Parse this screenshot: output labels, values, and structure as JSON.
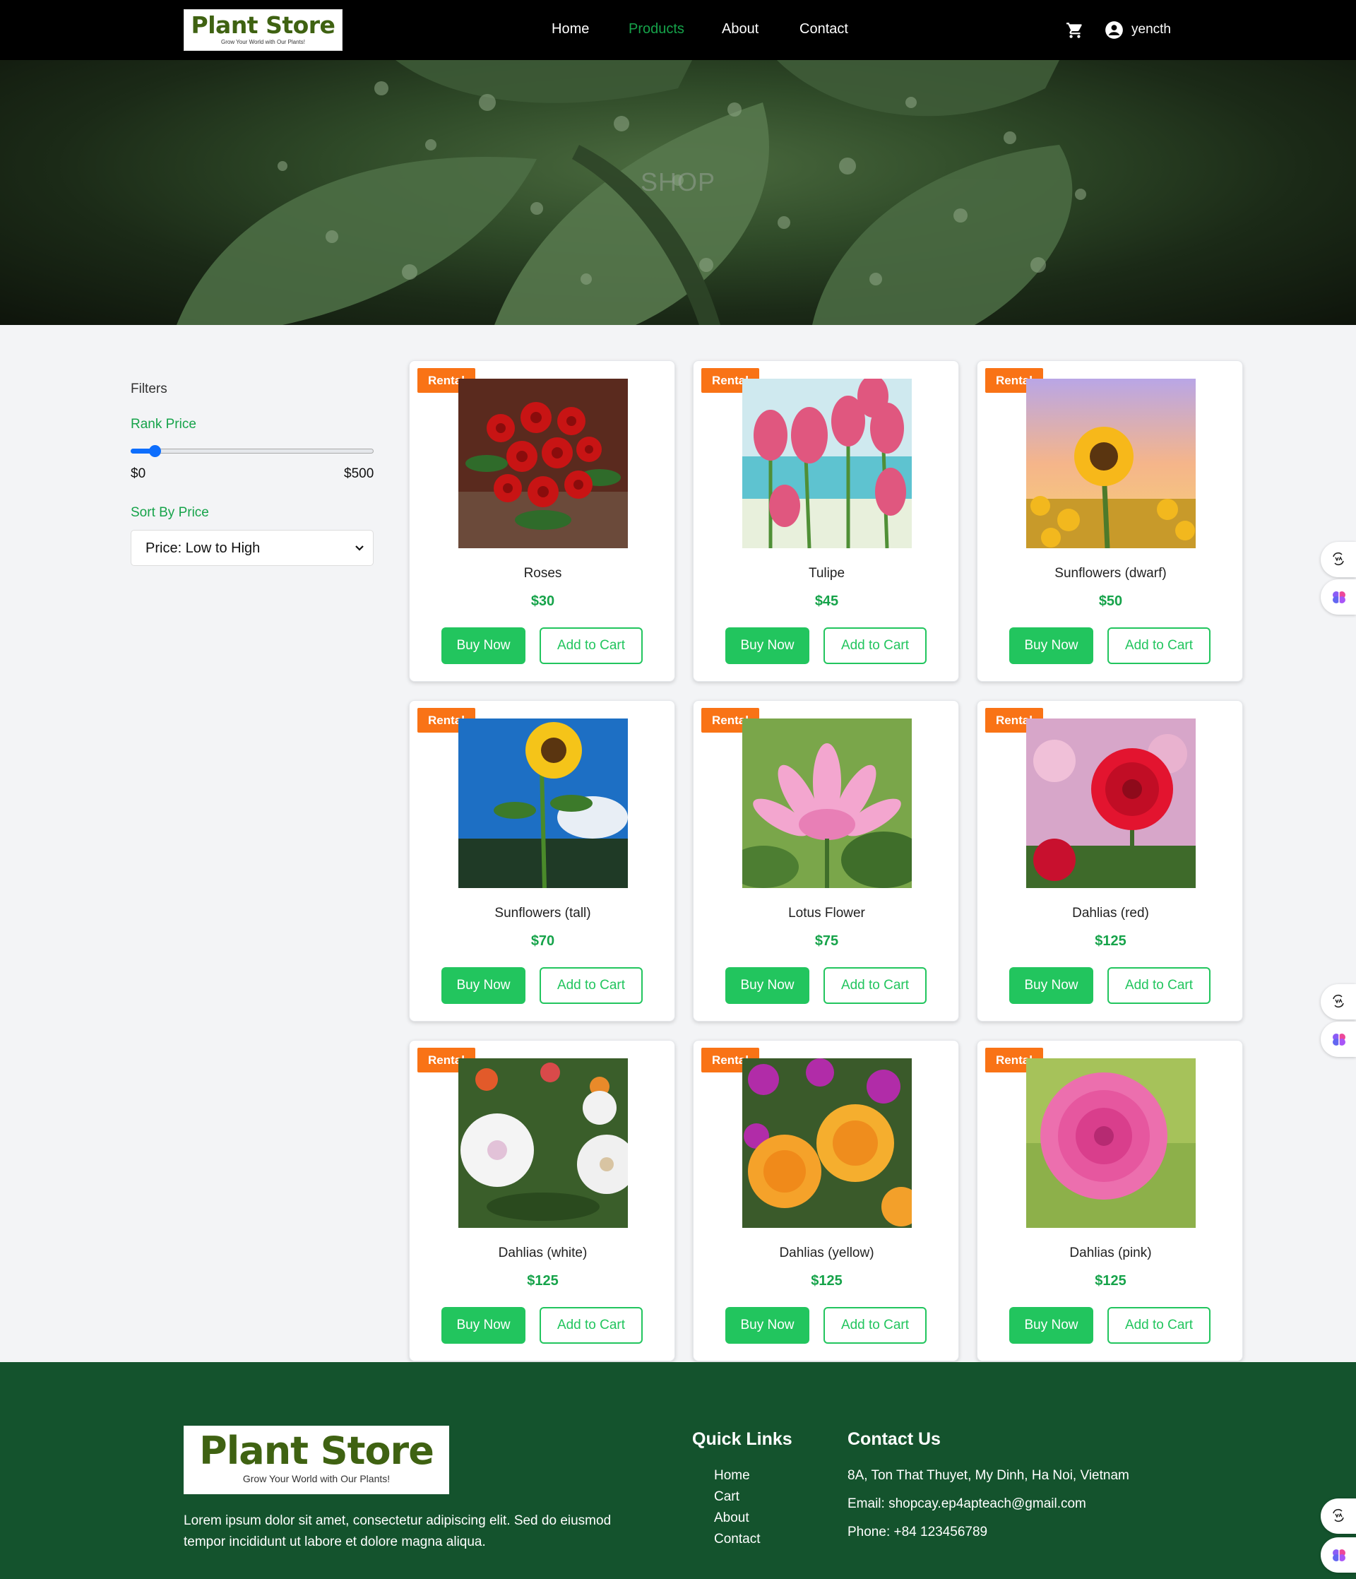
{
  "brand": {
    "name": "Plant Store",
    "tagline": "Grow Your World with Our Plants!"
  },
  "nav": {
    "items": [
      "Home",
      "Products",
      "About",
      "Contact"
    ],
    "active": "Products",
    "cart_icon": "cart-icon",
    "user_icon": "user-circle-icon",
    "user_name": "yencth"
  },
  "hero": {
    "title": "SHOP"
  },
  "filters": {
    "title": "Filters",
    "rank_label": "Rank Price",
    "min_label": "$0",
    "max_label": "$500",
    "slider_value_fraction": 0.1,
    "sort_label": "Sort By Price",
    "sort_selected": "Price: Low to High"
  },
  "products": [
    {
      "badge": "Rental",
      "name": "Roses",
      "price": "$30",
      "buy": "Buy Now",
      "cart": "Add to Cart"
    },
    {
      "badge": "Rental",
      "name": "Tulipe",
      "price": "$45",
      "buy": "Buy Now",
      "cart": "Add to Cart"
    },
    {
      "badge": "Rental",
      "name": "Sunflowers (dwarf)",
      "price": "$50",
      "buy": "Buy Now",
      "cart": "Add to Cart"
    },
    {
      "badge": "Rental",
      "name": "Sunflowers (tall)",
      "price": "$70",
      "buy": "Buy Now",
      "cart": "Add to Cart"
    },
    {
      "badge": "Rental",
      "name": "Lotus Flower",
      "price": "$75",
      "buy": "Buy Now",
      "cart": "Add to Cart"
    },
    {
      "badge": "Rental",
      "name": "Dahlias (red)",
      "price": "$125",
      "buy": "Buy Now",
      "cart": "Add to Cart"
    },
    {
      "badge": "Rental",
      "name": "Dahlias (white)",
      "price": "$125",
      "buy": "Buy Now",
      "cart": "Add to Cart"
    },
    {
      "badge": "Rental",
      "name": "Dahlias (yellow)",
      "price": "$125",
      "buy": "Buy Now",
      "cart": "Add to Cart"
    },
    {
      "badge": "Rental",
      "name": "Dahlias (pink)",
      "price": "$125",
      "buy": "Buy Now",
      "cart": "Add to Cart"
    }
  ],
  "footer": {
    "description": "Lorem ipsum dolor sit amet, consectetur adipiscing elit. Sed do eiusmod tempor incididunt ut labore et dolore magna aliqua.",
    "quick_links_title": "Quick Links",
    "quick_links": [
      "Home",
      "Cart",
      "About",
      "Contact"
    ],
    "contact_title": "Contact Us",
    "address": "8A, Ton That Thuyet, My Dinh, Ha Noi, Vietnam",
    "email": "Email: shopcay.ep4apteach@gmail.com",
    "phone": "Phone: +84 123456789"
  },
  "colors": {
    "accent": "#22c55e",
    "badge": "#f97316",
    "footer": "#14532d",
    "logo": "#3f6212"
  }
}
